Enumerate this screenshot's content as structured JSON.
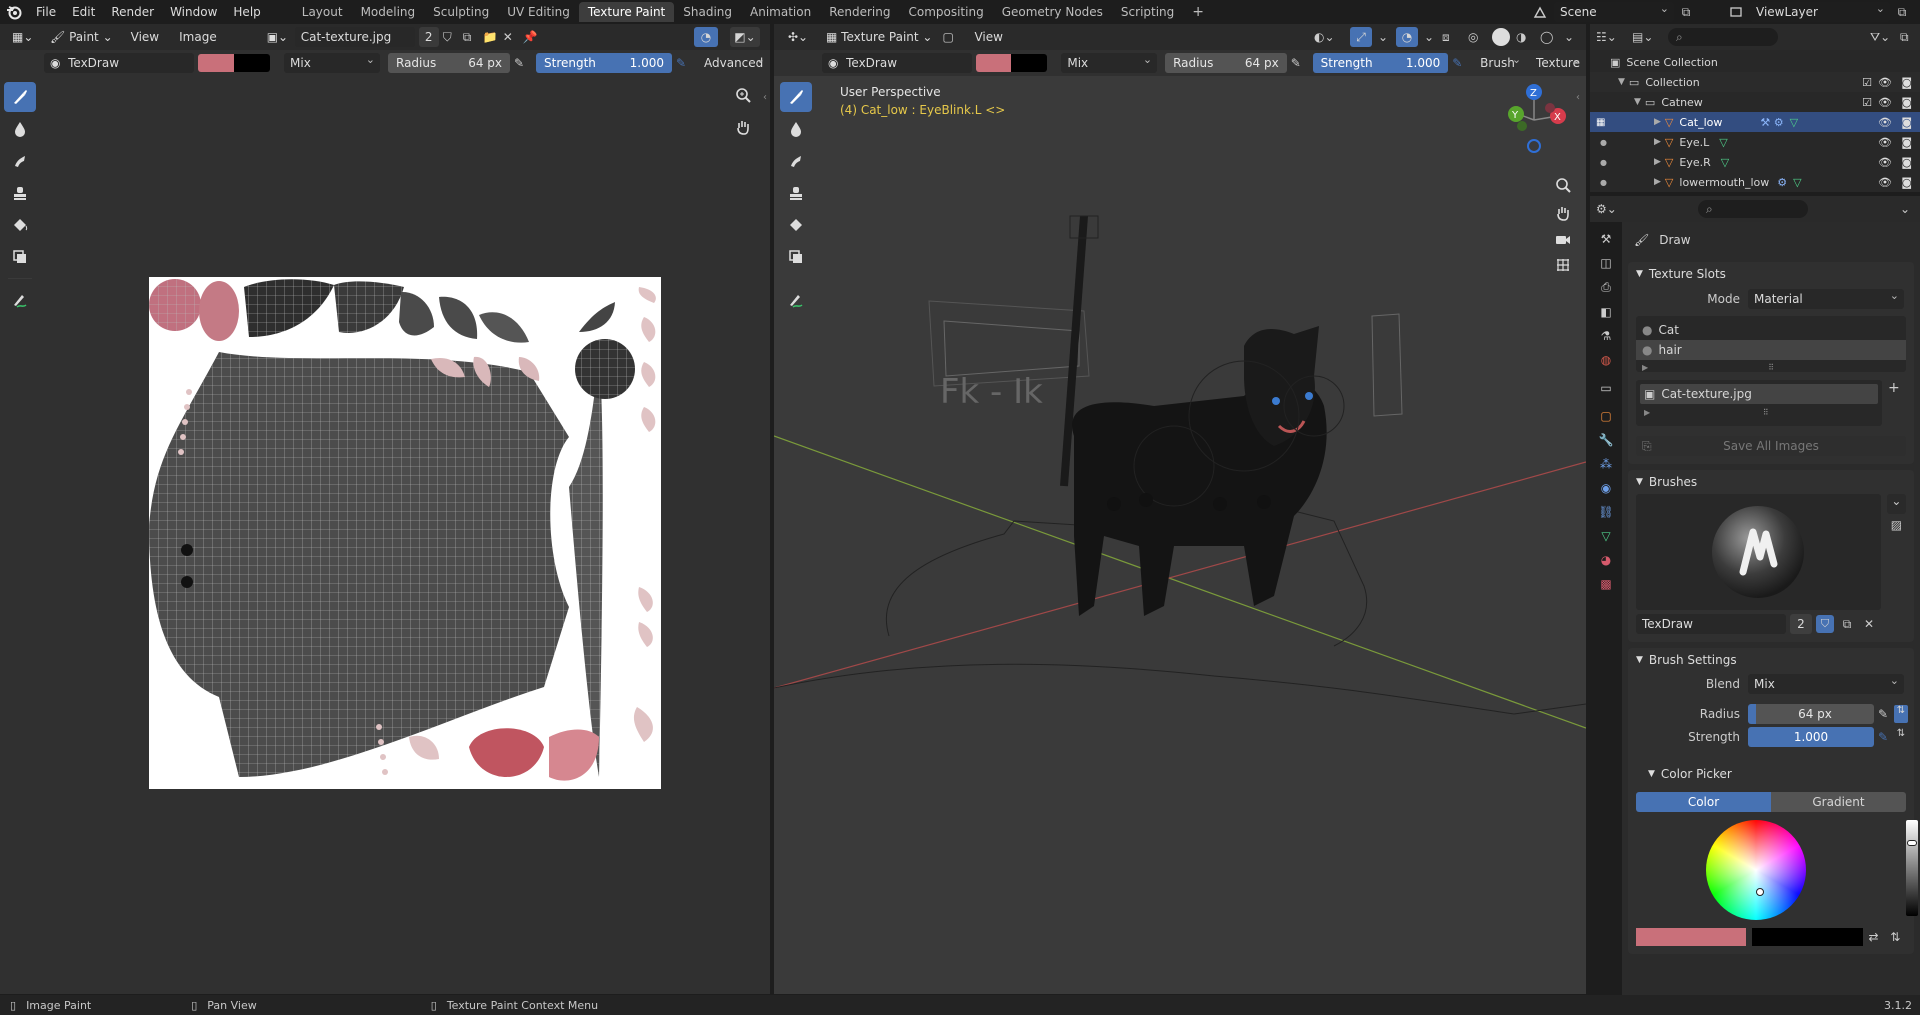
{
  "topbar": {
    "menus": [
      "File",
      "Edit",
      "Render",
      "Window",
      "Help"
    ],
    "workspaces": [
      "Layout",
      "Modeling",
      "Sculpting",
      "UV Editing",
      "Texture Paint",
      "Shading",
      "Animation",
      "Rendering",
      "Compositing",
      "Geometry Nodes",
      "Scripting"
    ],
    "active_workspace": "Texture Paint",
    "scene": "Scene",
    "view_layer": "ViewLayer"
  },
  "image_editor": {
    "mode": "Paint",
    "menus": [
      "View",
      "Image"
    ],
    "image_name": "Cat-texture.jpg",
    "users": "2",
    "tool_header": {
      "brush": "TexDraw",
      "blend": "Mix",
      "radius_label": "Radius",
      "radius_value": "64 px",
      "strength_label": "Strength",
      "strength_value": "1.000",
      "advanced": "Advanced"
    }
  },
  "viewport": {
    "mode": "Texture Paint",
    "menu": "View",
    "perspective": "User Perspective",
    "object_info": "(4) Cat_low : EyeBlink.L <>",
    "tool_header": {
      "brush": "TexDraw",
      "blend": "Mix",
      "radius_label": "Radius",
      "radius_value": "64 px",
      "strength_label": "Strength",
      "strength_value": "1.000",
      "brush_menu": "Brush",
      "texture_menu": "Texture"
    },
    "board_text": "Fk - Ik"
  },
  "outliner": {
    "items": [
      {
        "label": "Scene Collection",
        "indent": 0
      },
      {
        "label": "Collection",
        "indent": 1
      },
      {
        "label": "Catnew",
        "indent": 2
      },
      {
        "label": "Cat_low",
        "indent": 3,
        "selected": true
      },
      {
        "label": "Eye.L",
        "indent": 3
      },
      {
        "label": "Eye.R",
        "indent": 3
      },
      {
        "label": "lowermouth_low",
        "indent": 3
      }
    ]
  },
  "properties": {
    "tool": "Draw",
    "texture_slots": {
      "title": "Texture Slots",
      "mode_label": "Mode",
      "mode_value": "Material",
      "materials": [
        "Cat",
        "hair"
      ],
      "image": "Cat-texture.jpg",
      "save_all": "Save All Images"
    },
    "brushes": {
      "title": "Brushes",
      "name": "TexDraw",
      "users": "2"
    },
    "brush_settings": {
      "title": "Brush Settings",
      "blend_label": "Blend",
      "blend_value": "Mix",
      "radius_label": "Radius",
      "radius_value": "64 px",
      "strength_label": "Strength",
      "strength_value": "1.000"
    },
    "color_picker": {
      "title": "Color Picker",
      "tab_color": "Color",
      "tab_gradient": "Gradient"
    }
  },
  "status_bar": {
    "left": "Image Paint",
    "middle": "Pan View",
    "right": "Texture Paint Context Menu",
    "version": "3.1.2"
  },
  "colors": {
    "accent": "#4772b3",
    "paint_color": "#c9707a",
    "secondary_color": "#000000",
    "background": "#1d1d1d"
  }
}
